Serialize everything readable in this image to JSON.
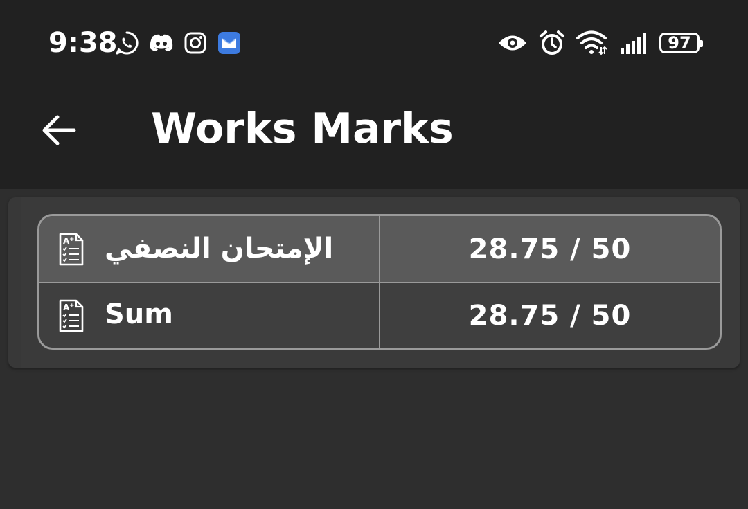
{
  "status_bar": {
    "time": "9:38",
    "left_icons": [
      "whatsapp-icon",
      "discord-icon",
      "instagram-icon",
      "mail-icon"
    ],
    "right_icons": [
      "eye-icon",
      "alarm-icon",
      "wifi-icon",
      "signal-icon"
    ],
    "battery_level": "97"
  },
  "app_bar": {
    "title": "Works Marks",
    "back_icon": "arrow-left-icon"
  },
  "marks": {
    "rows": [
      {
        "label": "الإمتحان النصفي",
        "value": "28.75 / 50",
        "icon": "grade-document-icon"
      },
      {
        "label": "Sum",
        "value": "28.75 / 50",
        "icon": "grade-document-icon"
      }
    ]
  },
  "colors": {
    "status_bar_bg": "#212121",
    "app_bar_bg": "#212121",
    "page_bg": "#2e2e2e",
    "card_bg": "#3a3a3a",
    "row_highlight": "#5a5a5a",
    "table_border": "#9a9a9a",
    "text": "#ffffff"
  }
}
